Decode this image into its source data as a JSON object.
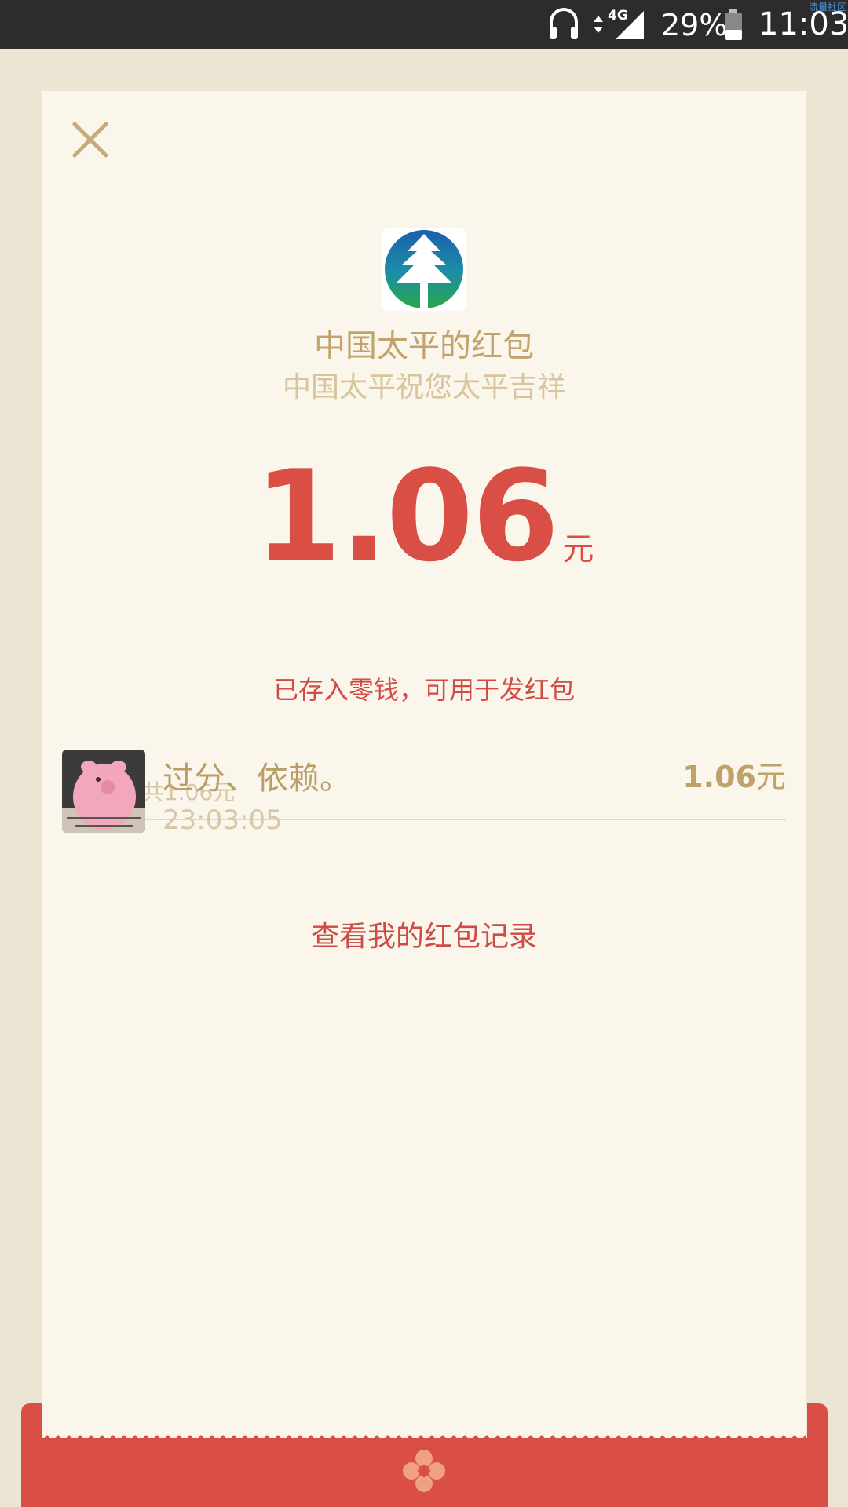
{
  "status_bar": {
    "network": "4G",
    "battery_percent": "29%",
    "time": "11:03"
  },
  "watermark": "流量社区",
  "red_packet": {
    "sender_title": "中国太平的红包",
    "blessing": "中国太平祝您太平吉祥",
    "amount": "1.06",
    "unit": "元",
    "note": "已存入零钱，可用于发红包",
    "summary": "1个红包共1.06元",
    "record": {
      "name": "过分、依赖。",
      "time": "23:03:05",
      "amount": "1.06",
      "unit": "元"
    },
    "history_link": "查看我的红包记录"
  },
  "icons": {
    "close": "close-icon",
    "logo": "china-taiping-logo",
    "headphones": "headphones-icon",
    "signal": "signal-icon",
    "battery": "battery-icon",
    "flower": "flower-icon"
  },
  "colors": {
    "accent_red": "#d94e45",
    "gold": "#c2a36c",
    "card_bg": "#faf6eb",
    "page_bg": "#ede5d3"
  }
}
